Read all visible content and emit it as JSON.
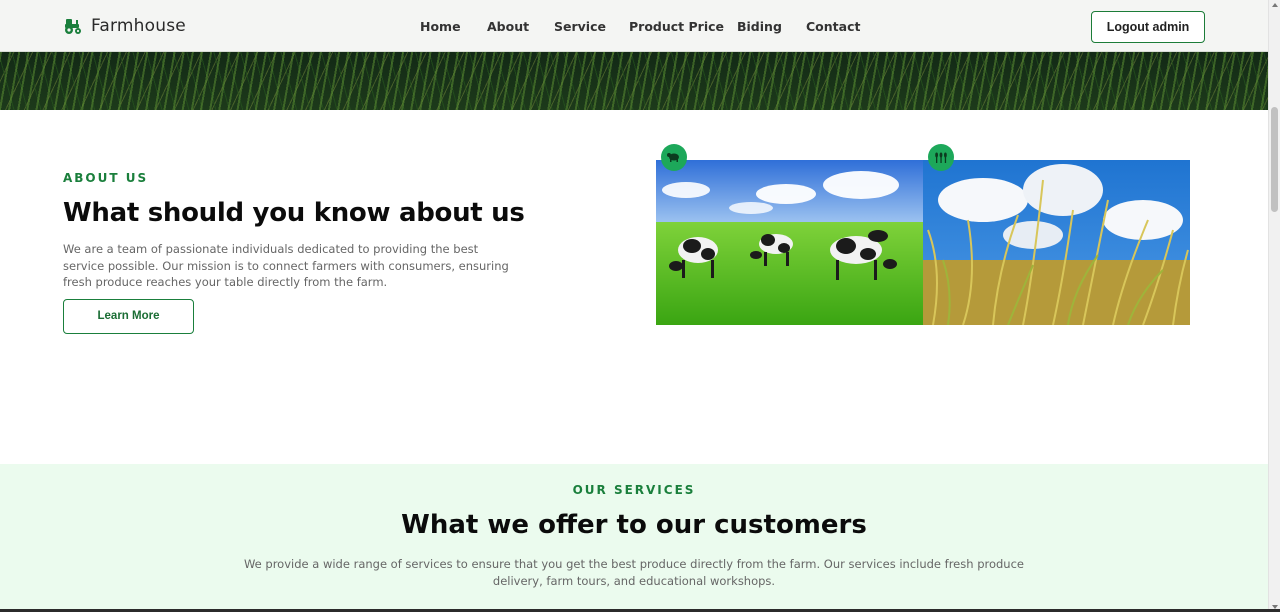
{
  "navbar": {
    "brand": "Farmhouse",
    "brand_icon": "tractor-icon",
    "links": [
      "Home",
      "About",
      "Service",
      "Product Price",
      "Biding",
      "Contact"
    ],
    "logout_label": "Logout admin"
  },
  "about": {
    "eyebrow": "ABOUT US",
    "title": "What should you know about us",
    "text": "We are a team of passionate individuals dedicated to providing the best service possible. Our mission is to connect farmers with consumers, ensuring fresh produce reaches your table directly from the farm.",
    "button_label": "Learn More",
    "images": [
      {
        "name": "cows-grazing-photo",
        "badge_icon": "cow-icon"
      },
      {
        "name": "wheat-field-photo",
        "badge_icon": "crops-icon"
      }
    ]
  },
  "services": {
    "eyebrow": "OUR SERVICES",
    "title": "What we offer to our customers",
    "text": "We provide a wide range of services to ensure that you get the best produce directly from the farm. Our services include fresh produce delivery, farm tours, and educational workshops."
  },
  "colors": {
    "accent": "#1a7f3c",
    "badge": "#1da85a",
    "services_bg": "#ebfbee",
    "navbar_bg": "#f4f5f3"
  }
}
